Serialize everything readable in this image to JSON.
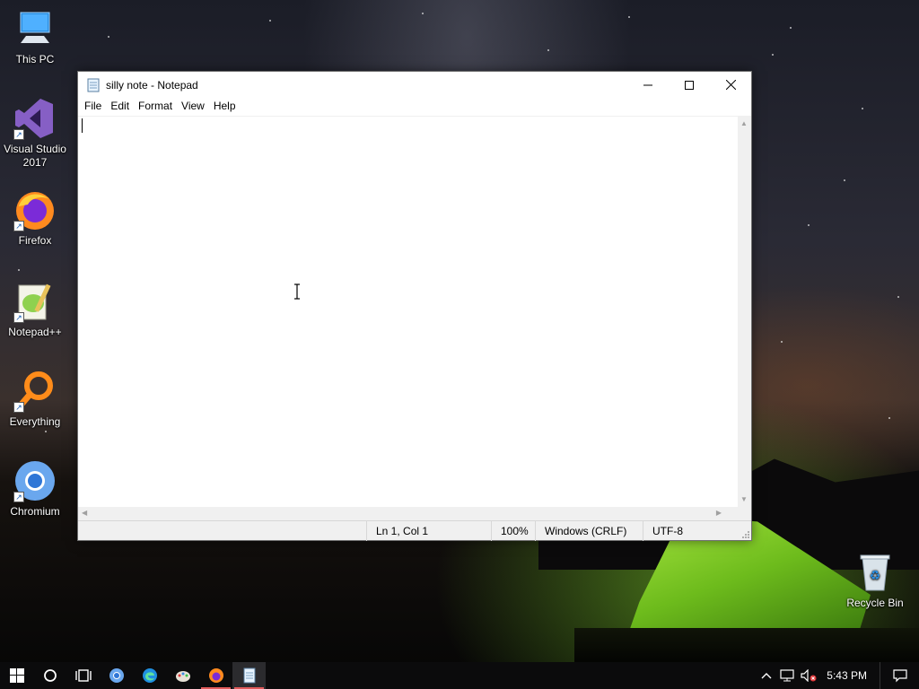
{
  "desktop": {
    "icons": [
      {
        "label": "This PC",
        "icon": "this-pc-icon"
      },
      {
        "label": "Visual Studio\n2017",
        "line1": "Visual Studio",
        "line2": "2017",
        "icon": "visual-studio-icon"
      },
      {
        "label": "Firefox",
        "icon": "firefox-icon"
      },
      {
        "label": "Notepad++",
        "icon": "notepad-plus-plus-icon"
      },
      {
        "label": "Everything",
        "icon": "everything-search-icon"
      },
      {
        "label": "Chromium",
        "icon": "chromium-icon"
      },
      {
        "label": "Recycle Bin",
        "icon": "recycle-bin-icon"
      }
    ]
  },
  "window": {
    "title": "silly note - Notepad",
    "controls": [
      "minimize",
      "maximize",
      "close"
    ],
    "menu": [
      "File",
      "Edit",
      "Format",
      "View",
      "Help"
    ],
    "editor_text": "",
    "status": {
      "position": "Ln 1, Col 1",
      "zoom": "100%",
      "line_endings": "Windows (CRLF)",
      "encoding": "UTF-8"
    }
  },
  "taskbar": {
    "items": [
      "start-icon",
      "search-icon",
      "task-view-icon",
      "chromium-icon",
      "edge-icon",
      "paint-icon",
      "firefox-icon",
      "notepad-icon"
    ],
    "active": "notepad-icon",
    "tray": [
      "chevron-up-icon",
      "network-icon",
      "volume-muted-icon"
    ],
    "clock": "5:43 PM",
    "notification_icon": "action-center-icon"
  },
  "colors": {
    "taskbar_bg": "#0b0b0c",
    "active_indicator": "#e05a5a",
    "window_chrome": "#f0f0f0"
  }
}
